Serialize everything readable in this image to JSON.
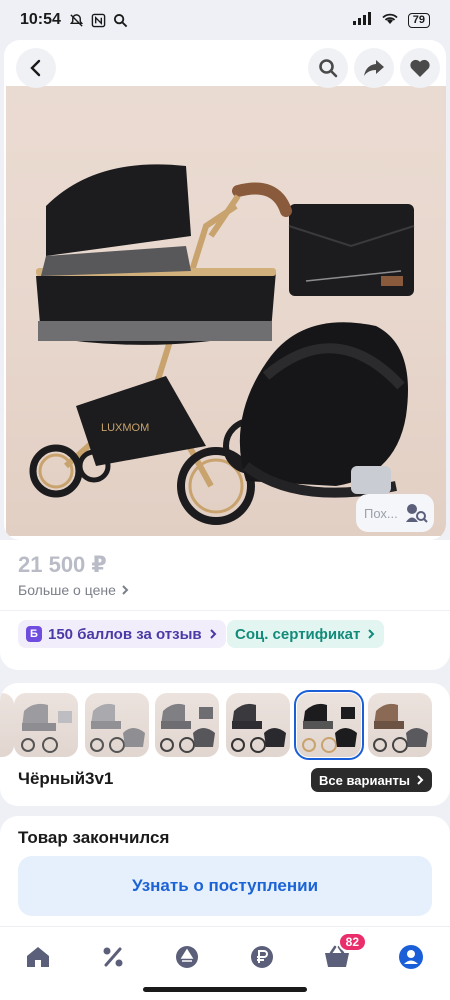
{
  "status_bar": {
    "time": "10:54",
    "battery": "79"
  },
  "header": {
    "back_icon": "chevron-left-icon",
    "search_icon": "search-icon",
    "share_icon": "share-arrow-icon",
    "favorite_icon": "heart-icon"
  },
  "product": {
    "brand_on_photo": "LUXMOM",
    "similar_label": "Пох..."
  },
  "price": {
    "value": "21 500 ₽",
    "more_label": "Больше о цене"
  },
  "chips": {
    "points_badge": "Б",
    "points_label": "150 баллов за отзыв",
    "certificate_label": "Соц. сертификат"
  },
  "variants": {
    "selected_index": 4,
    "count": 6,
    "name": "Чёрный3v1",
    "all_label": "Все варианты"
  },
  "stock": {
    "title": "Товар закончился",
    "notify_label": "Узнать о поступлении"
  },
  "bottom_nav": {
    "items": [
      "home-icon",
      "percent-icon",
      "lamp-icon",
      "ruble-icon",
      "basket-icon",
      "profile-icon"
    ],
    "cart_count": "82"
  },
  "colors": {
    "accent": "#1c63d6",
    "badge": "#ea2d6b",
    "cert": "#138b7a",
    "points": "#4b3aa6"
  }
}
